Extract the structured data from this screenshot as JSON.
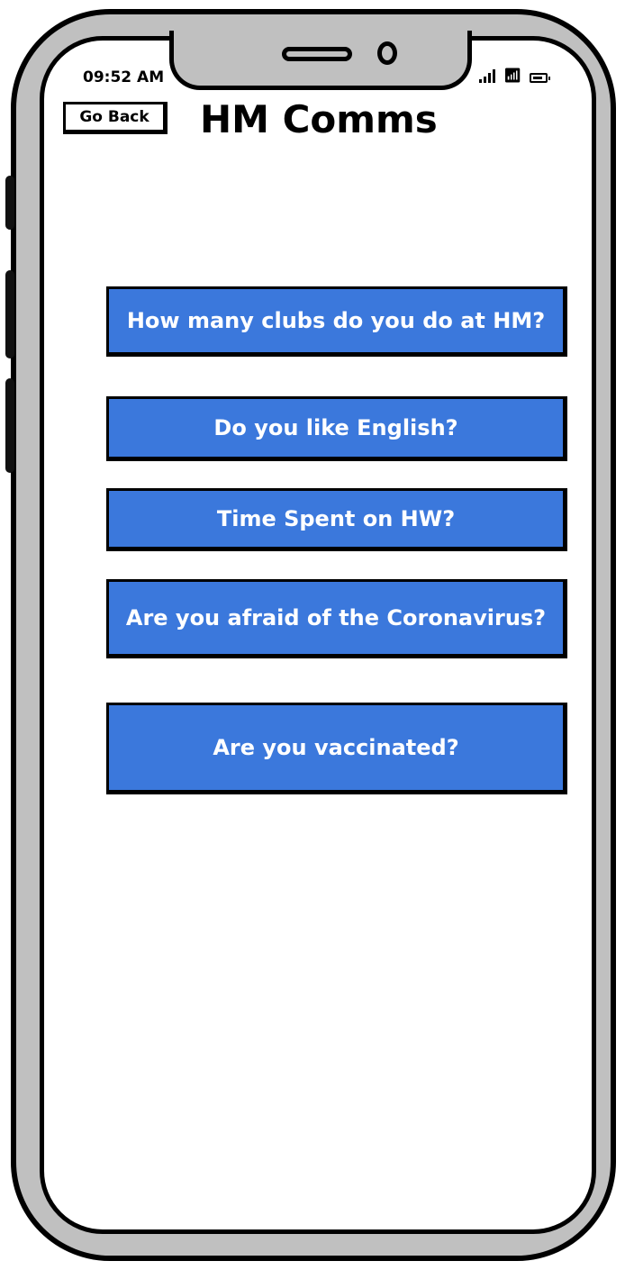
{
  "status_bar": {
    "time": "09:52 AM",
    "icons": [
      "signal-icon",
      "wifi-icon",
      "battery-icon"
    ]
  },
  "header": {
    "back_label": "Go Back",
    "title": "HM Comms"
  },
  "questions": [
    "How many clubs do you do at HM?",
    "Do you like English?",
    "Time Spent on HW?",
    "Are you afraid of the Coronavirus?",
    "Are you vaccinated?"
  ],
  "colors": {
    "button_blue": "#3b78dc",
    "frame_gray": "#c0c0c0"
  }
}
